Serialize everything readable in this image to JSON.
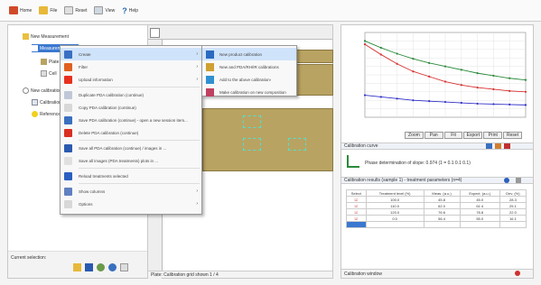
{
  "toolbar": {
    "buttons": [
      {
        "label": "Home",
        "icon": "home-icon",
        "color": "#d04a2a"
      },
      {
        "label": "File",
        "icon": "folder-icon",
        "color": "#e8b83a"
      },
      {
        "label": "Reset",
        "icon": "page-icon",
        "color": "#dcdcdc"
      },
      {
        "label": "View",
        "icon": "window-icon",
        "color": "#cfd8e0"
      },
      {
        "label": "Help",
        "icon": "question-icon",
        "color": "#2a6ab0"
      }
    ]
  },
  "tree": {
    "items": [
      {
        "label": "New Measurement",
        "level": 0
      },
      {
        "label": "Measurement",
        "level": 1,
        "selected": true
      },
      {
        "label": "Plate",
        "level": 2
      },
      {
        "label": "Cell",
        "level": 2
      },
      {
        "label": "New calibration",
        "level": 0
      },
      {
        "label": "Calibration",
        "level": 1
      },
      {
        "label": "Reference",
        "level": 1
      }
    ],
    "status_label": "Current selection:"
  },
  "context_menu": {
    "items": [
      {
        "label": "Create",
        "icon": "create-icon",
        "color": "#3a6fc4",
        "submenu": true,
        "highlight": true
      },
      {
        "label": "Filter",
        "icon": "filter-icon",
        "color": "#e06020",
        "submenu": true
      },
      {
        "label": "Upload information",
        "icon": "upload-icon",
        "color": "#e83020",
        "submenu": true
      },
      {
        "label": "Duplicate PDA calibration (continue)",
        "icon": "duplicate-icon",
        "color": "#c0c8d8"
      },
      {
        "label": "Copy PDA calibration (continue)",
        "icon": "copy-icon",
        "color": "#d8d8d8"
      },
      {
        "label": "Save PDA calibration (continue) - open a new session item...",
        "icon": "save-icon",
        "color": "#3a70c0"
      },
      {
        "label": "Delete PDA calibration (continue)",
        "icon": "delete-icon",
        "color": "#d83020"
      },
      {
        "label": "Save all PDA calibration (continue) / images in ...",
        "icon": "save-all-icon",
        "color": "#2a5ab0"
      },
      {
        "label": "Save all images (PDA treatments) plots in ...",
        "icon": "images-icon",
        "color": "#e0e0e0"
      },
      {
        "label": "Reload treatments selected",
        "icon": "reload-icon",
        "color": "#2a60c0"
      },
      {
        "label": "Show columns",
        "icon": "columns-icon",
        "color": "#6080c0",
        "submenu": true
      },
      {
        "label": "Options",
        "icon": "options-icon",
        "color": "#d8d8d8",
        "submenu": true
      }
    ]
  },
  "submenu": {
    "items": [
      {
        "label": "New product calibration",
        "icon": "new-product-icon",
        "color": "#2a6ac0",
        "highlight": true
      },
      {
        "label": "New and PDA/RH/IR calibrations",
        "icon": "new-pda-icon",
        "color": "#d0a030"
      },
      {
        "label": "Add to the above calibration",
        "icon": "add-calibration-icon",
        "color": "#3090d0",
        "submenu": true
      },
      {
        "label": "Make calibration on new composition",
        "icon": "composition-icon",
        "color": "#c04060"
      }
    ]
  },
  "center": {
    "status_label": "Plate:  Calibration grid shown   1 / 4"
  },
  "right": {
    "chart_toolbar": [
      "Zoom",
      "Pan",
      "Fit",
      "Export",
      "Print",
      "Reset"
    ],
    "calibration_label": "Calibration curve",
    "equation_label": "Phase determination of slope: 0.974 (1 = 0.1 0.1 0.1)",
    "table_title": "Calibration results (sample 1) - treatment parameters (n=4)",
    "table_headers": [
      "Select",
      "Treatment level (%)",
      "Meas. (a.u.)",
      "Expect. (a.u.)",
      "Dev. (%)"
    ],
    "table_rows": [
      [
        "on",
        "100.0",
        "45.8",
        "45.0",
        "28.3"
      ],
      [
        "on",
        "110.0",
        "62.0",
        "61.4",
        "25.1"
      ],
      [
        "on",
        "120.0",
        "76.6",
        "78.8",
        "22.0"
      ],
      [
        "on",
        "0.0",
        "56.4",
        "55.0",
        "16.1"
      ]
    ],
    "status_label": "Calibration window"
  },
  "chart_data": {
    "type": "line",
    "x": [
      0,
      1,
      2,
      3,
      4,
      5,
      6,
      7,
      8,
      9,
      10
    ],
    "series": [
      {
        "values": [
          9.0,
          8.2,
          7.5,
          6.9,
          6.4,
          6.0,
          5.6,
          5.2,
          4.9,
          4.6,
          4.4
        ],
        "color": "#2a8a3a"
      },
      {
        "values": [
          8.6,
          7.4,
          6.3,
          5.4,
          4.8,
          4.2,
          3.8,
          3.5,
          3.3,
          3.1,
          3.0
        ],
        "color": "#d83030"
      },
      {
        "values": [
          2.6,
          2.4,
          2.2,
          2.0,
          1.9,
          1.8,
          1.7,
          1.6,
          1.55,
          1.5,
          1.45
        ],
        "color": "#3030c8"
      }
    ],
    "ylim": [
      0,
      10
    ],
    "xlim": [
      0,
      10
    ],
    "grid": true
  }
}
